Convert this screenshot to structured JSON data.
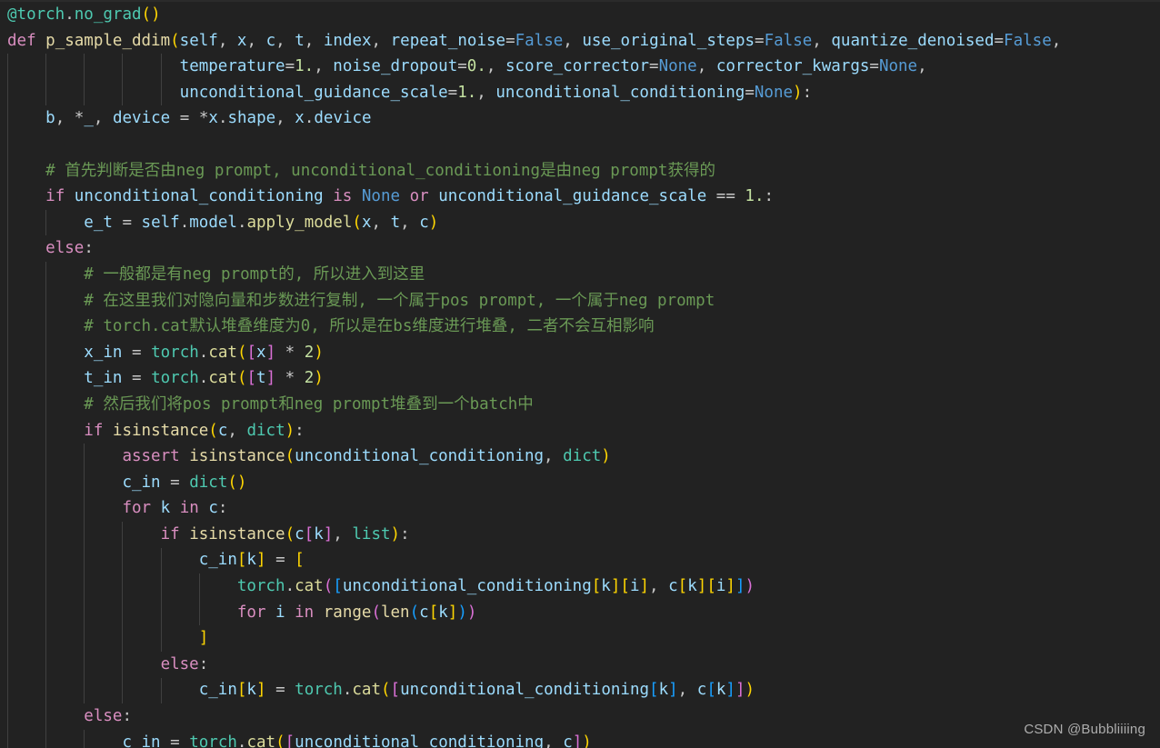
{
  "editor": {
    "background_color": "#222222",
    "font_size_px": 17.5,
    "line_height_px": 28.6,
    "language": "python",
    "theme": "dark-plus",
    "indent_guide_color": "#404040"
  },
  "colors": {
    "keyword": "#d98ec0",
    "constant": "#569cd6",
    "function": "#e6dba8",
    "builtin": "#4ec9b0",
    "method": "#dcdc9b",
    "variable": "#9cdcfe",
    "number": "#c3e0a0",
    "comment": "#6a9955",
    "operator": "#c8c8c8",
    "bracket_level_1": "#ffd602",
    "bracket_level_2": "#da70d6",
    "bracket_level_3": "#179fff"
  },
  "watermark": {
    "text": "CSDN @Bubbliiiing"
  },
  "code": {
    "lines": [
      "@torch.no_grad()",
      "def p_sample_ddim(self, x, c, t, index, repeat_noise=False, use_original_steps=False, quantize_denoised=False,",
      "                  temperature=1., noise_dropout=0., score_corrector=None, corrector_kwargs=None,",
      "                  unconditional_guidance_scale=1., unconditional_conditioning=None):",
      "    b, *_, device = *x.shape, x.device",
      "",
      "    # 首先判断是否由neg prompt, unconditional_conditioning是由neg prompt获得的",
      "    if unconditional_conditioning is None or unconditional_guidance_scale == 1.:",
      "        e_t = self.model.apply_model(x, t, c)",
      "    else:",
      "        # 一般都是有neg prompt的, 所以进入到这里",
      "        # 在这里我们对隐向量和步数进行复制, 一个属于pos prompt, 一个属于neg prompt",
      "        # torch.cat默认堆叠维度为0, 所以是在bs维度进行堆叠, 二者不会互相影响",
      "        x_in = torch.cat([x] * 2)",
      "        t_in = torch.cat([t] * 2)",
      "        # 然后我们将pos prompt和neg prompt堆叠到一个batch中",
      "        if isinstance(c, dict):",
      "            assert isinstance(unconditional_conditioning, dict)",
      "            c_in = dict()",
      "            for k in c:",
      "                if isinstance(c[k], list):",
      "                    c_in[k] = [",
      "                        torch.cat([unconditional_conditioning[k][i], c[k][i]])",
      "                        for i in range(len(c[k]))",
      "                    ]",
      "                else:",
      "                    c_in[k] = torch.cat([unconditional_conditioning[k], c[k]])",
      "        else:",
      "            c_in = torch.cat([unconditional_conditioning, c])"
    ]
  }
}
